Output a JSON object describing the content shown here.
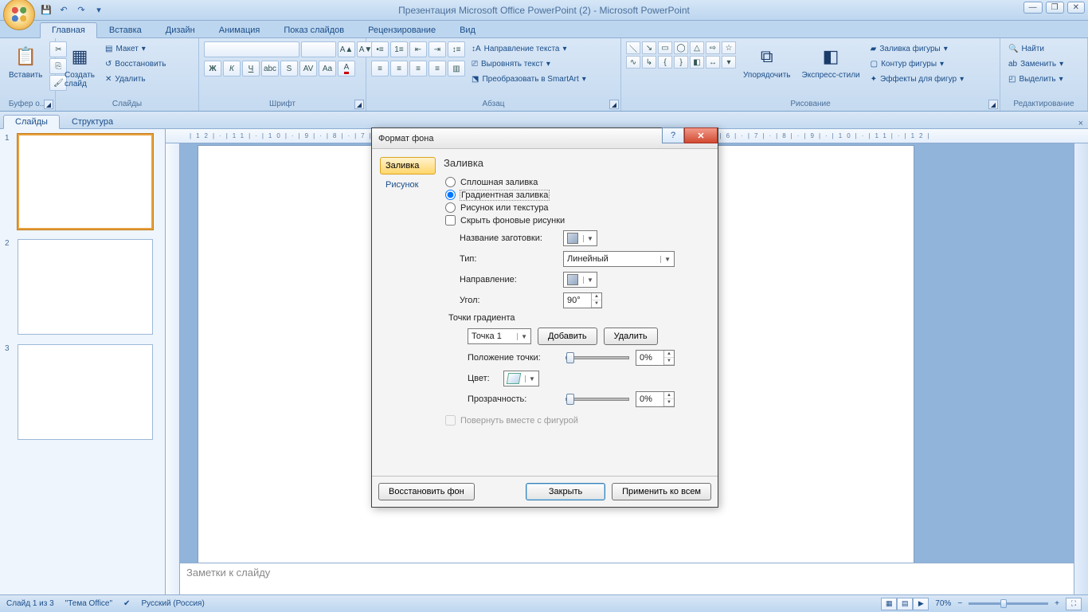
{
  "window": {
    "title": "Презентация Microsoft Office PowerPoint (2) - Microsoft PowerPoint",
    "min": "—",
    "max": "❐",
    "close": "✕"
  },
  "qat": {
    "save": "💾",
    "undo": "↶",
    "redo": "↷",
    "custom": "▾"
  },
  "tabs": [
    "Главная",
    "Вставка",
    "Дизайн",
    "Анимация",
    "Показ слайдов",
    "Рецензирование",
    "Вид"
  ],
  "ribbon": {
    "clipboard": {
      "paste": "Вставить",
      "group": "Буфер о..."
    },
    "slides": {
      "new": "Создать\nслайд",
      "layout": "Макет",
      "reset": "Восстановить",
      "delete": "Удалить",
      "group": "Слайды"
    },
    "font": {
      "group": "Шрифт"
    },
    "paragraph": {
      "textdir": "Направление текста",
      "align": "Выровнять текст",
      "smartart": "Преобразовать в SmartArt",
      "group": "Абзац"
    },
    "drawing": {
      "arrange": "Упорядочить",
      "styles": "Экспресс-стили",
      "fill": "Заливка фигуры",
      "outline": "Контур фигуры",
      "effects": "Эффекты для фигур",
      "group": "Рисование"
    },
    "editing": {
      "find": "Найти",
      "replace": "Заменить",
      "select": "Выделить",
      "group": "Редактирование"
    }
  },
  "side_panel": {
    "slides": "Слайды",
    "outline": "Структура",
    "close": "×",
    "thumbs": [
      "1",
      "2",
      "3"
    ]
  },
  "ruler": "|12|·|11|·|10|·|9|·|8|·|7|·|6|·|5|·|4|·|3|·|2|·|1|·|0|·|1|·|2|·|3|·|4|·|5|·|6|·|7|·|8|·|9|·|10|·|11|·|12|",
  "notes_placeholder": "Заметки к слайду",
  "status": {
    "slide": "Слайд 1 из 3",
    "theme": "\"Тема Office\"",
    "lang": "Русский (Россия)",
    "zoom": "70%"
  },
  "dialog": {
    "title": "Формат фона",
    "nav": {
      "fill": "Заливка",
      "picture": "Рисунок"
    },
    "heading": "Заливка",
    "opts": {
      "solid": "Сплошная заливка",
      "gradient": "Градиентная заливка",
      "picture": "Рисунок или текстура",
      "hidebg": "Скрыть фоновые рисунки"
    },
    "preset_label": "Название заготовки:",
    "type_label": "Тип:",
    "type_value": "Линейный",
    "dir_label": "Направление:",
    "angle_label": "Угол:",
    "angle_value": "90°",
    "stops_label": "Точки градиента",
    "stop_selected": "Точка 1",
    "add": "Добавить",
    "remove": "Удалить",
    "pos_label": "Положение точки:",
    "pos_value": "0%",
    "color_label": "Цвет:",
    "transp_label": "Прозрачность:",
    "transp_value": "0%",
    "rotate_label": "Повернуть вместе с фигурой",
    "reset": "Восстановить фон",
    "close": "Закрыть",
    "apply": "Применить ко всем"
  }
}
